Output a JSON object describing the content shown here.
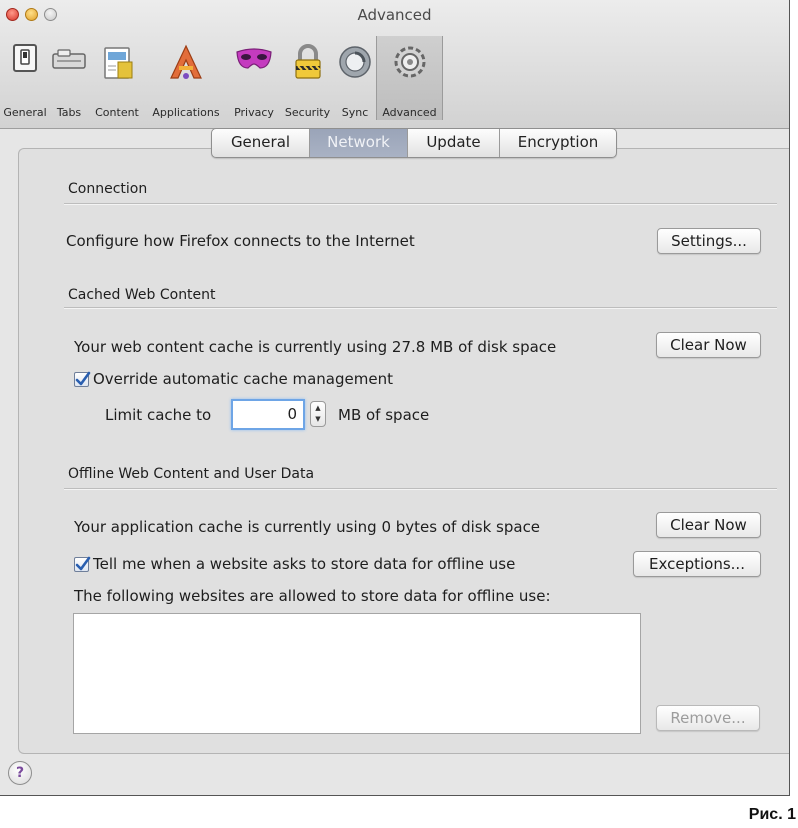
{
  "window": {
    "title": "Advanced"
  },
  "toolbar": {
    "items": [
      {
        "label": "General",
        "icon": "general-switch-icon"
      },
      {
        "label": "Tabs",
        "icon": "tabs-icon"
      },
      {
        "label": "Content",
        "icon": "content-document-icon"
      },
      {
        "label": "Applications",
        "icon": "applications-icon"
      },
      {
        "label": "Privacy",
        "icon": "privacy-mask-icon"
      },
      {
        "label": "Security",
        "icon": "security-lock-icon"
      },
      {
        "label": "Sync",
        "icon": "sync-icon"
      },
      {
        "label": "Advanced",
        "icon": "advanced-gear-icon",
        "selected": true
      }
    ]
  },
  "tabs": [
    {
      "label": "General"
    },
    {
      "label": "Network",
      "active": true
    },
    {
      "label": "Update"
    },
    {
      "label": "Encryption"
    }
  ],
  "connection": {
    "title": "Connection",
    "description": "Configure how Firefox connects to the Internet",
    "settings_button": "Settings..."
  },
  "cache": {
    "title": "Cached Web Content",
    "usage_text": "Your web content cache is currently using 27.8 MB of disk space",
    "clear_button": "Clear Now",
    "override_label": "Override automatic cache management",
    "override_checked": true,
    "limit_label": "Limit cache to",
    "limit_value": "0",
    "limit_unit": "MB of space"
  },
  "offline": {
    "title": "Offline Web Content and User Data",
    "usage_text": "Your application cache is currently using 0 bytes of disk space",
    "clear_button": "Clear Now",
    "notify_label": "Tell me when a website asks to store data for offline use",
    "notify_checked": true,
    "exceptions_button": "Exceptions...",
    "allowed_label": "The following websites are allowed to store data for offline use:",
    "allowed_sites": [],
    "remove_button": "Remove..."
  },
  "help": {
    "label": "?"
  },
  "caption": "Рис. 1",
  "colors": {
    "selected_tab": "#9aa4b8",
    "checkbox_tick": "#2a5fb0",
    "focus_ring": "#6ea5e6",
    "help_mark": "#7a4b9c"
  }
}
